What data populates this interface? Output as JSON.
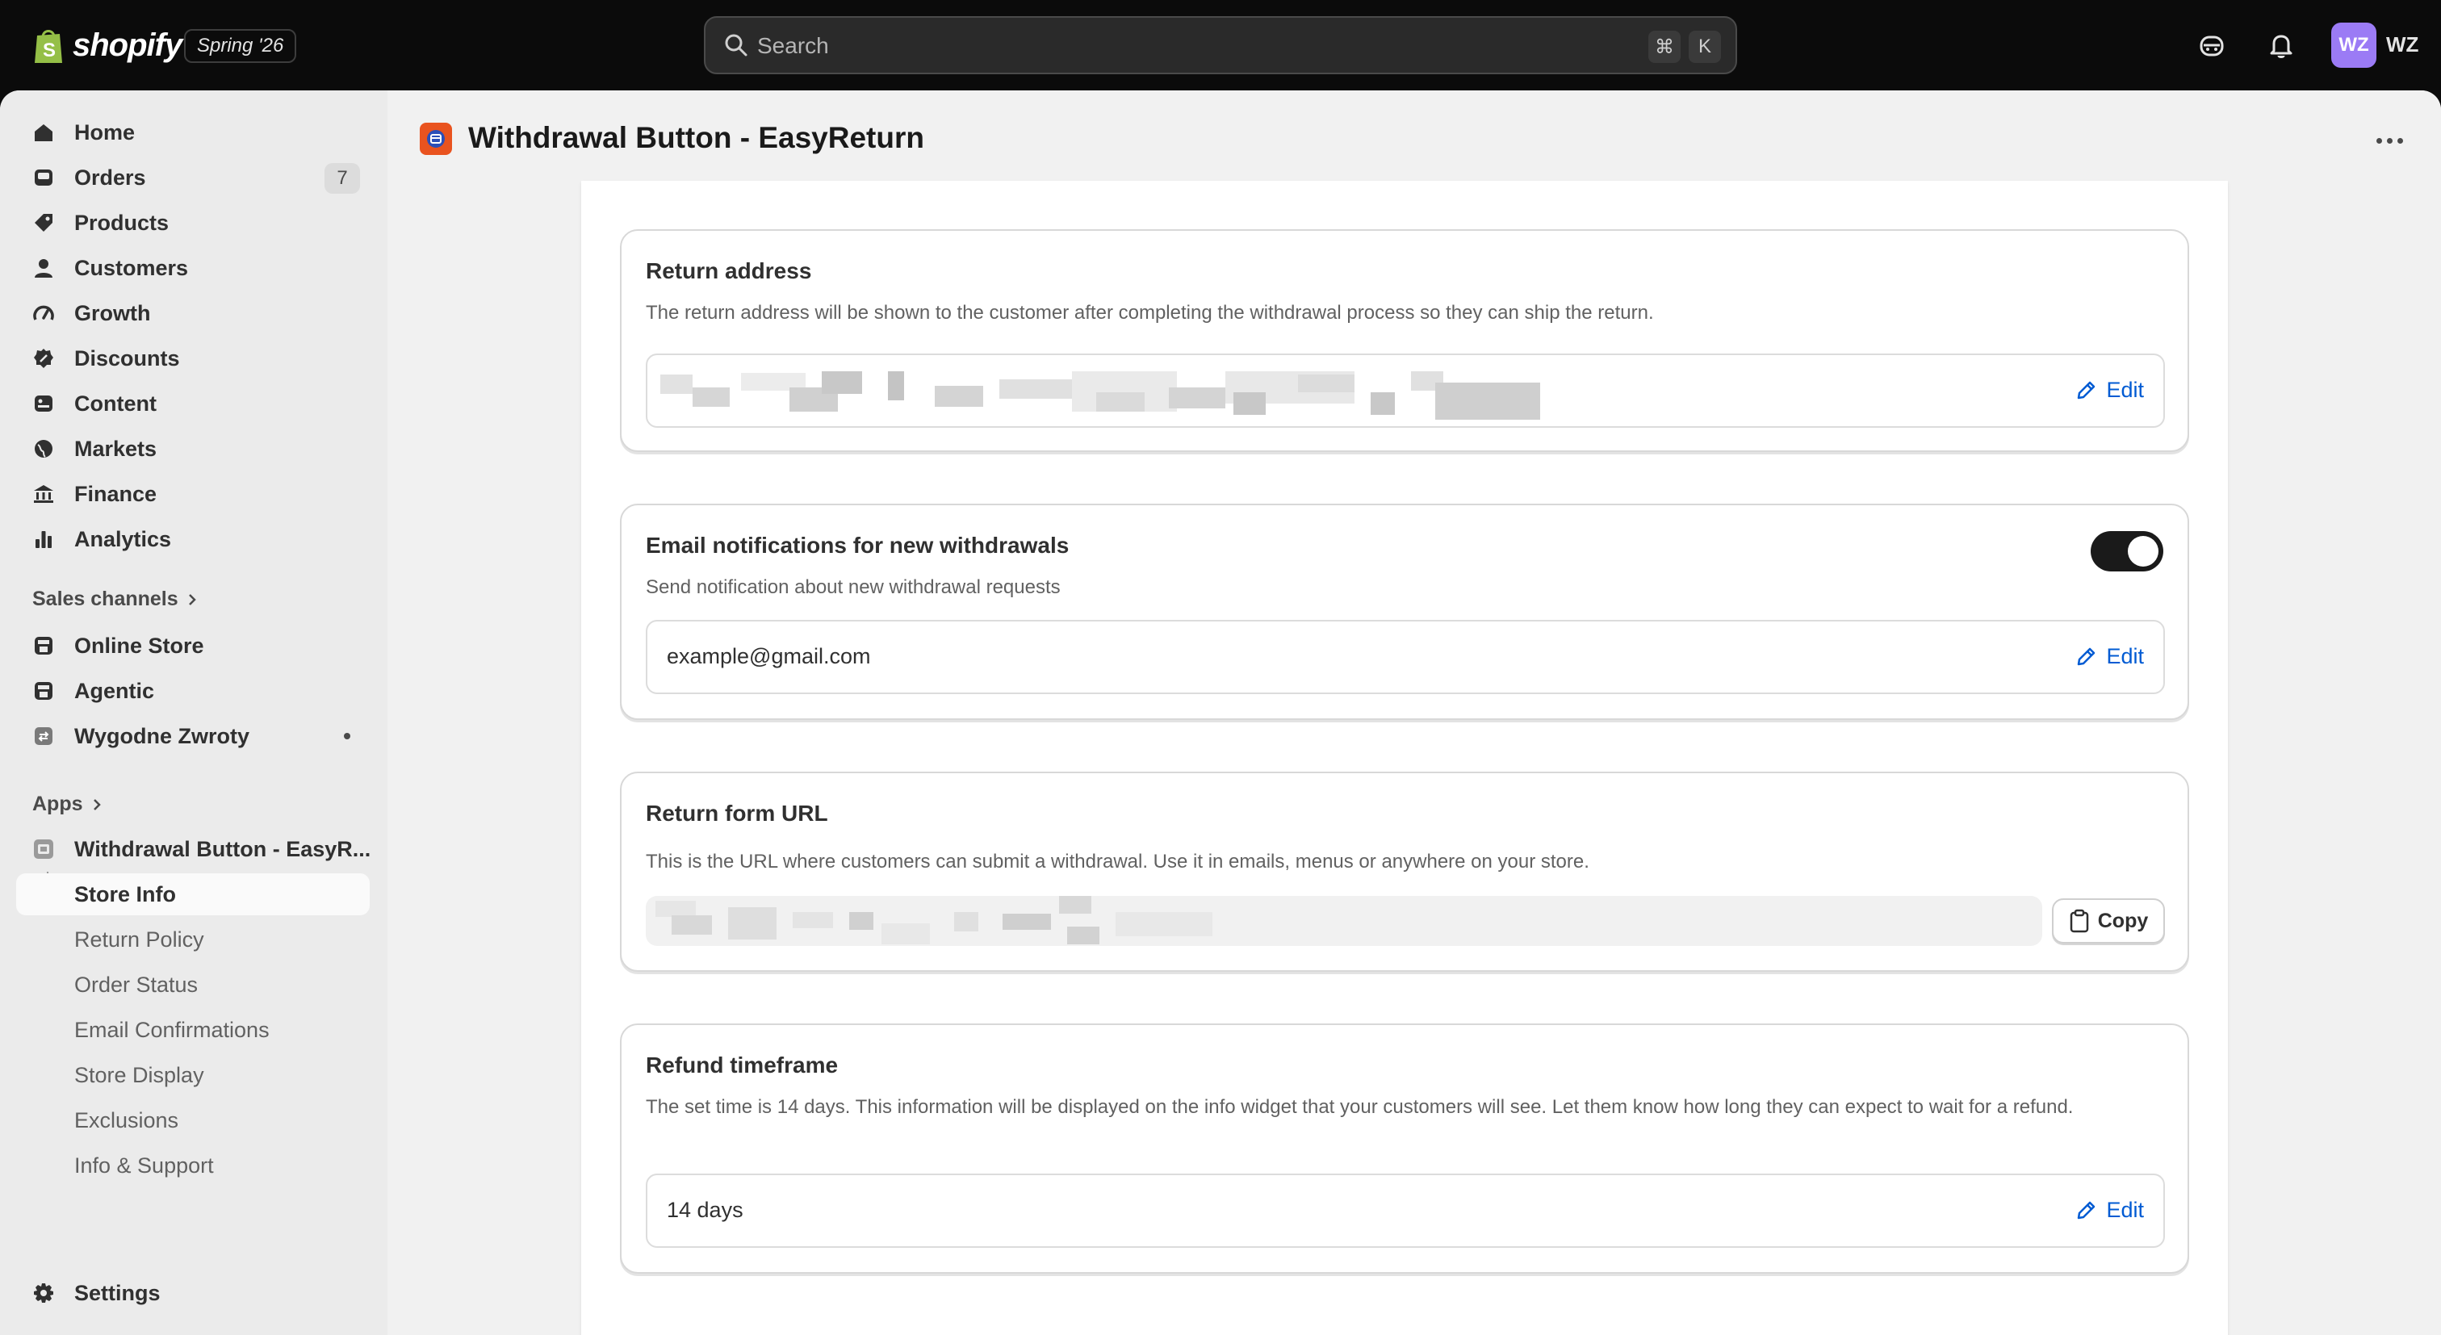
{
  "topbar": {
    "brand": "shopify",
    "edition": "Spring '26",
    "search_placeholder": "Search",
    "shortcut_cmd": "⌘",
    "shortcut_key": "K",
    "avatar_initials": "WZ",
    "user_name": "WZ"
  },
  "sidebar": {
    "main": [
      {
        "label": "Home",
        "icon": "home-icon"
      },
      {
        "label": "Orders",
        "icon": "orders-icon",
        "badge": "7"
      },
      {
        "label": "Products",
        "icon": "tag-icon"
      },
      {
        "label": "Customers",
        "icon": "person-icon"
      },
      {
        "label": "Growth",
        "icon": "gauge-icon"
      },
      {
        "label": "Discounts",
        "icon": "discount-icon"
      },
      {
        "label": "Content",
        "icon": "content-icon"
      },
      {
        "label": "Markets",
        "icon": "globe-icon"
      },
      {
        "label": "Finance",
        "icon": "bank-icon"
      },
      {
        "label": "Analytics",
        "icon": "bar-chart-icon"
      }
    ],
    "sales_channels_label": "Sales channels",
    "channels": [
      {
        "label": "Online Store",
        "icon": "store-icon"
      },
      {
        "label": "Agentic",
        "icon": "store-icon"
      },
      {
        "label": "Wygodne Zwroty",
        "icon": "return-icon"
      }
    ],
    "apps_label": "Apps",
    "app": {
      "label": "Withdrawal Button - EasyR...",
      "icon": "app-icon"
    },
    "app_pages": [
      {
        "label": "Store Info"
      },
      {
        "label": "Return Policy"
      },
      {
        "label": "Order Status"
      },
      {
        "label": "Email Confirmations"
      },
      {
        "label": "Store Display"
      },
      {
        "label": "Exclusions"
      },
      {
        "label": "Info & Support"
      }
    ],
    "settings_label": "Settings"
  },
  "page": {
    "title": "Withdrawal Button - EasyReturn"
  },
  "sections": {
    "return_address": {
      "title": "Return address",
      "description": "The return address will be shown to the customer after completing the withdrawal process so they can ship the return.",
      "edit_label": "Edit"
    },
    "email_notifications": {
      "title": "Email notifications for new withdrawals",
      "description": "Send notification about new withdrawal requests",
      "toggle_on": true,
      "value": "example@gmail.com",
      "edit_label": "Edit"
    },
    "return_form_url": {
      "title": "Return form URL",
      "description": "This is the URL where customers can submit a withdrawal. Use it in emails, menus or anywhere on your store.",
      "copy_label": "Copy"
    },
    "refund_timeframe": {
      "title": "Refund timeframe",
      "description": "The set time is 14 days. This information will be displayed on the info widget that your customers will see. Let them know how long they can expect to wait for a refund.",
      "value": "14 days",
      "edit_label": "Edit"
    }
  },
  "colors": {
    "accent_link": "#005bd3",
    "app_icon": "#e9531f",
    "avatar": "#9b7bf5"
  }
}
